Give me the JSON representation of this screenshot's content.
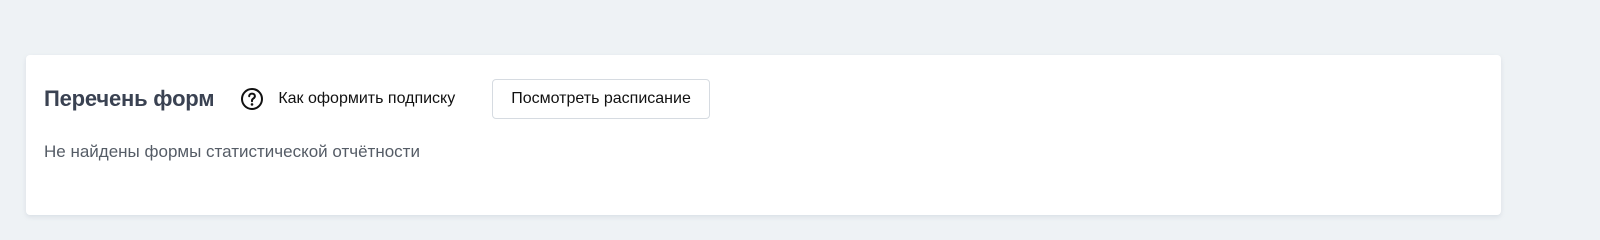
{
  "forms_panel": {
    "title": "Перечень форм",
    "help_link": {
      "icon": "question-circle-icon",
      "label": "Как оформить подписку"
    },
    "schedule_button_label": "Посмотреть расписание",
    "empty_message": "Не найдены формы статистической отчётности"
  },
  "colors": {
    "page_background": "#eef2f5",
    "card_background": "#ffffff",
    "title_color": "#3a4252",
    "muted_text": "#555c66"
  }
}
